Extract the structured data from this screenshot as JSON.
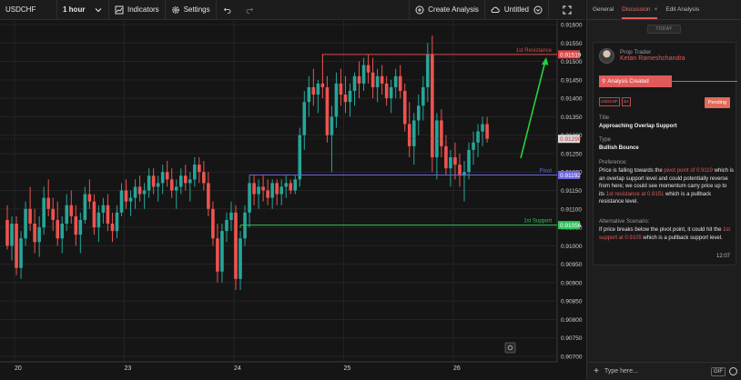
{
  "toolbar": {
    "symbol": "USDCHF",
    "interval": "1 hour",
    "indicators_label": "Indicators",
    "settings_label": "Settings",
    "create_analysis_label": "Create Analysis",
    "untitled_label": "Untitled"
  },
  "panel": {
    "tabs": [
      {
        "label": "General"
      },
      {
        "label": "Discussion"
      },
      {
        "label": "Edit Analysis"
      }
    ],
    "today_label": "TODAY",
    "role": "Prop Trader",
    "author": "Ketan Rameshchandra",
    "analysis_created": "Analysis Created",
    "tag_symbol": "USDCHF",
    "tag_interval": "1H",
    "status": "Pending",
    "title_label": "Title",
    "title_value": "Approaching Overlap Support",
    "type_label": "Type",
    "type_value": "Bullish Bounce",
    "preference_label": "Preference:",
    "preference_parts": [
      "Price is falling towards the ",
      "pivot point of 0.9119",
      " which is an overlap support level and could potentially reverse from here; we could see momentum carry price up to its ",
      "1st resistance at 0.9151",
      " which is a pullback resistance level."
    ],
    "alt_label": "Alternative Scenario:",
    "alt_parts": [
      "If price breaks below the pivot point, it could hit the ",
      "1st support at 0.9105",
      " which is a pullback support level."
    ],
    "time": "12:07",
    "input_placeholder": "Type here...",
    "gif_label": "GIF"
  },
  "chart_data": {
    "type": "candlestick",
    "symbol": "USDCHF",
    "interval": "1 hour",
    "ylim": [
      0.907,
      0.916
    ],
    "y_ticks": [
      "0.91600",
      "0.91550",
      "0.91500",
      "0.91450",
      "0.91400",
      "0.91350",
      "0.91300",
      "0.91250",
      "0.91200",
      "0.91150",
      "0.91100",
      "0.91050",
      "0.91000",
      "0.90950",
      "0.90900",
      "0.90850",
      "0.90800",
      "0.90750",
      "0.90700"
    ],
    "x_ticks": [
      {
        "label": "20",
        "bar": 2
      },
      {
        "label": "23",
        "bar": 26
      },
      {
        "label": "24",
        "bar": 50
      },
      {
        "label": "25",
        "bar": 74
      },
      {
        "label": "26",
        "bar": 98
      }
    ],
    "levels": [
      {
        "name": "1st Resistance",
        "value": 0.91519,
        "label": "0.91519",
        "color": "#e04848",
        "start_bar": 69
      },
      {
        "name": "Pivot",
        "value": 0.91192,
        "label": "0.91192",
        "color": "#6b66e0",
        "start_bar": 53
      },
      {
        "name": "1st Support",
        "value": 0.91056,
        "label": "0.91056",
        "color": "#2fc45a",
        "start_bar": 51
      }
    ],
    "current_price": {
      "value": 0.9129,
      "label": "0.91290"
    },
    "bull_color": "#26a69a",
    "bear_color": "#ef5350",
    "candles": [
      [
        0.9107,
        0.9111,
        0.9099,
        0.91
      ],
      [
        0.91,
        0.9108,
        0.9096,
        0.9106
      ],
      [
        0.9106,
        0.9108,
        0.9092,
        0.9094
      ],
      [
        0.9094,
        0.9104,
        0.9091,
        0.9102
      ],
      [
        0.9102,
        0.9112,
        0.91,
        0.911
      ],
      [
        0.911,
        0.9116,
        0.9104,
        0.9106
      ],
      [
        0.9106,
        0.911,
        0.9098,
        0.9101
      ],
      [
        0.9101,
        0.9108,
        0.9097,
        0.9105
      ],
      [
        0.9105,
        0.9116,
        0.9103,
        0.9113
      ],
      [
        0.9113,
        0.9118,
        0.9108,
        0.911
      ],
      [
        0.911,
        0.9113,
        0.9104,
        0.9107
      ],
      [
        0.9107,
        0.9112,
        0.91,
        0.9102
      ],
      [
        0.9102,
        0.9108,
        0.9098,
        0.9106
      ],
      [
        0.9106,
        0.9114,
        0.9104,
        0.9111
      ],
      [
        0.9111,
        0.9115,
        0.9106,
        0.9108
      ],
      [
        0.9108,
        0.9111,
        0.91,
        0.9103
      ],
      [
        0.9103,
        0.9109,
        0.9098,
        0.9107
      ],
      [
        0.9107,
        0.9116,
        0.9106,
        0.9114
      ],
      [
        0.9114,
        0.9118,
        0.911,
        0.9112
      ],
      [
        0.9112,
        0.9114,
        0.9103,
        0.9105
      ],
      [
        0.9105,
        0.9111,
        0.9101,
        0.9109
      ],
      [
        0.9109,
        0.9113,
        0.9106,
        0.9111
      ],
      [
        0.9111,
        0.9114,
        0.9104,
        0.9106
      ],
      [
        0.9106,
        0.9109,
        0.9101,
        0.9104
      ],
      [
        0.9104,
        0.9111,
        0.9102,
        0.9109
      ],
      [
        0.9109,
        0.9117,
        0.9108,
        0.9115
      ],
      [
        0.9115,
        0.9118,
        0.911,
        0.9112
      ],
      [
        0.9112,
        0.9115,
        0.9108,
        0.9113
      ],
      [
        0.9113,
        0.9118,
        0.911,
        0.9116
      ],
      [
        0.9116,
        0.9119,
        0.9112,
        0.9114
      ],
      [
        0.9114,
        0.9117,
        0.911,
        0.9115
      ],
      [
        0.9115,
        0.9121,
        0.9113,
        0.9119
      ],
      [
        0.9119,
        0.9121,
        0.9114,
        0.9116
      ],
      [
        0.9116,
        0.9119,
        0.9112,
        0.9117
      ],
      [
        0.9117,
        0.9122,
        0.9114,
        0.912
      ],
      [
        0.912,
        0.9123,
        0.9116,
        0.9118
      ],
      [
        0.9118,
        0.9121,
        0.9113,
        0.9115
      ],
      [
        0.9115,
        0.9118,
        0.911,
        0.9116
      ],
      [
        0.9116,
        0.9121,
        0.9114,
        0.9119
      ],
      [
        0.9119,
        0.9122,
        0.9115,
        0.9117
      ],
      [
        0.9117,
        0.912,
        0.9112,
        0.9118
      ],
      [
        0.9118,
        0.9124,
        0.9116,
        0.9122
      ],
      [
        0.9122,
        0.9124,
        0.9117,
        0.912
      ],
      [
        0.912,
        0.9123,
        0.9115,
        0.9117
      ],
      [
        0.9117,
        0.912,
        0.9108,
        0.911
      ],
      [
        0.911,
        0.9112,
        0.91,
        0.9102
      ],
      [
        0.9102,
        0.9106,
        0.909,
        0.9093
      ],
      [
        0.9093,
        0.9106,
        0.909,
        0.9104
      ],
      [
        0.9104,
        0.9109,
        0.9101,
        0.9107
      ],
      [
        0.9107,
        0.9112,
        0.9104,
        0.9109
      ],
      [
        0.9109,
        0.9111,
        0.9088,
        0.9091
      ],
      [
        0.9091,
        0.9104,
        0.9088,
        0.9102
      ],
      [
        0.9102,
        0.9111,
        0.91,
        0.9109
      ],
      [
        0.9109,
        0.9119,
        0.9105,
        0.9117
      ],
      [
        0.9117,
        0.9119,
        0.9111,
        0.9114
      ],
      [
        0.9114,
        0.9118,
        0.911,
        0.9116
      ],
      [
        0.9116,
        0.9119,
        0.9112,
        0.9115
      ],
      [
        0.9115,
        0.9118,
        0.9111,
        0.9113
      ],
      [
        0.9113,
        0.9118,
        0.911,
        0.9117
      ],
      [
        0.9117,
        0.9118,
        0.9111,
        0.9114
      ],
      [
        0.9114,
        0.9118,
        0.9111,
        0.9116
      ],
      [
        0.9116,
        0.9119,
        0.9113,
        0.9117
      ],
      [
        0.9117,
        0.9118,
        0.9114,
        0.9115
      ],
      [
        0.9115,
        0.9119,
        0.9114,
        0.9118
      ],
      [
        0.9118,
        0.9132,
        0.9116,
        0.913
      ],
      [
        0.913,
        0.9142,
        0.9126,
        0.9139
      ],
      [
        0.9139,
        0.9146,
        0.9135,
        0.9143
      ],
      [
        0.9143,
        0.9148,
        0.9138,
        0.9141
      ],
      [
        0.9141,
        0.9145,
        0.9136,
        0.9144
      ],
      [
        0.9144,
        0.9152,
        0.914,
        0.9143
      ],
      [
        0.9143,
        0.9146,
        0.9128,
        0.913
      ],
      [
        0.913,
        0.9138,
        0.912,
        0.9135
      ],
      [
        0.9135,
        0.9147,
        0.9132,
        0.9144
      ],
      [
        0.9144,
        0.9148,
        0.9138,
        0.9141
      ],
      [
        0.9141,
        0.9146,
        0.9136,
        0.9139
      ],
      [
        0.9139,
        0.9144,
        0.9135,
        0.9142
      ],
      [
        0.9142,
        0.9147,
        0.9138,
        0.9146
      ],
      [
        0.9146,
        0.915,
        0.914,
        0.9144
      ],
      [
        0.9144,
        0.9151,
        0.9142,
        0.9149
      ],
      [
        0.9149,
        0.9152,
        0.9144,
        0.9147
      ],
      [
        0.9147,
        0.9151,
        0.914,
        0.9143
      ],
      [
        0.9143,
        0.9148,
        0.9139,
        0.9146
      ],
      [
        0.9146,
        0.9149,
        0.9141,
        0.9144
      ],
      [
        0.9144,
        0.9146,
        0.9138,
        0.914
      ],
      [
        0.914,
        0.9145,
        0.9136,
        0.9143
      ],
      [
        0.9143,
        0.9148,
        0.914,
        0.9146
      ],
      [
        0.9146,
        0.9149,
        0.914,
        0.9142
      ],
      [
        0.9142,
        0.9144,
        0.9131,
        0.9133
      ],
      [
        0.9133,
        0.9139,
        0.9124,
        0.9127
      ],
      [
        0.9127,
        0.9136,
        0.9122,
        0.9134
      ],
      [
        0.9134,
        0.9141,
        0.913,
        0.9138
      ],
      [
        0.9138,
        0.9146,
        0.9134,
        0.9143
      ],
      [
        0.9143,
        0.9155,
        0.9139,
        0.9152
      ],
      [
        0.9152,
        0.9157,
        0.912,
        0.9124
      ],
      [
        0.9124,
        0.9136,
        0.9118,
        0.9134
      ],
      [
        0.9134,
        0.9137,
        0.9124,
        0.9127
      ],
      [
        0.9127,
        0.913,
        0.9119,
        0.9121
      ],
      [
        0.9121,
        0.9126,
        0.9116,
        0.9124
      ],
      [
        0.9124,
        0.9128,
        0.9118,
        0.9122
      ],
      [
        0.9122,
        0.9125,
        0.9116,
        0.9119
      ],
      [
        0.9119,
        0.9123,
        0.9112,
        0.912
      ],
      [
        0.912,
        0.9128,
        0.9118,
        0.9126
      ],
      [
        0.9126,
        0.9131,
        0.9122,
        0.9128
      ],
      [
        0.9128,
        0.9133,
        0.9124,
        0.9131
      ],
      [
        0.9131,
        0.9135,
        0.9127,
        0.9133
      ],
      [
        0.9133,
        0.9135,
        0.9128,
        0.9129
      ]
    ]
  }
}
